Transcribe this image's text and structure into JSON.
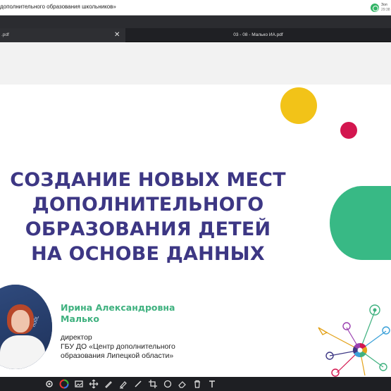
{
  "window": {
    "title": "дополнительного образования школьников»",
    "user_name": "Зол",
    "user_time": "29:38"
  },
  "tabs": [
    {
      "label": ".pdf",
      "close_glyph": "✕"
    },
    {
      "label": "03 - 08 - Малько ИА.pdf"
    }
  ],
  "slide": {
    "headline_lines": [
      "СОЗДАНИЕ НОВЫХ МЕСТ",
      "ДОПОЛНИТЕЛЬНОГО",
      "ОБРАЗОВАНИЯ ДЕТЕЙ",
      "НА ОСНОВЕ ДАННЫХ"
    ],
    "speaker_name_lines": [
      "Ирина Александровна",
      "Малько"
    ],
    "speaker_role_lines": [
      "директор",
      "ГБУ ДО «Центр дополнительного",
      "образования Липецкой области»"
    ],
    "photo_text": "HOOL",
    "colors": {
      "headline": "#3d3784",
      "speaker_name": "#3fb17f",
      "yellow_circle": "#f2c318",
      "pink_circle": "#d3164f",
      "green_circle": "#38b985"
    }
  },
  "toolbar": {
    "tools": [
      "gear-icon",
      "color-wheel-icon",
      "image-icon",
      "move-icon",
      "pen-icon",
      "highlighter-icon",
      "line-icon",
      "crop-icon",
      "eraser-icon",
      "shape-icon",
      "fill-icon",
      "trash-icon",
      "text-icon"
    ]
  }
}
